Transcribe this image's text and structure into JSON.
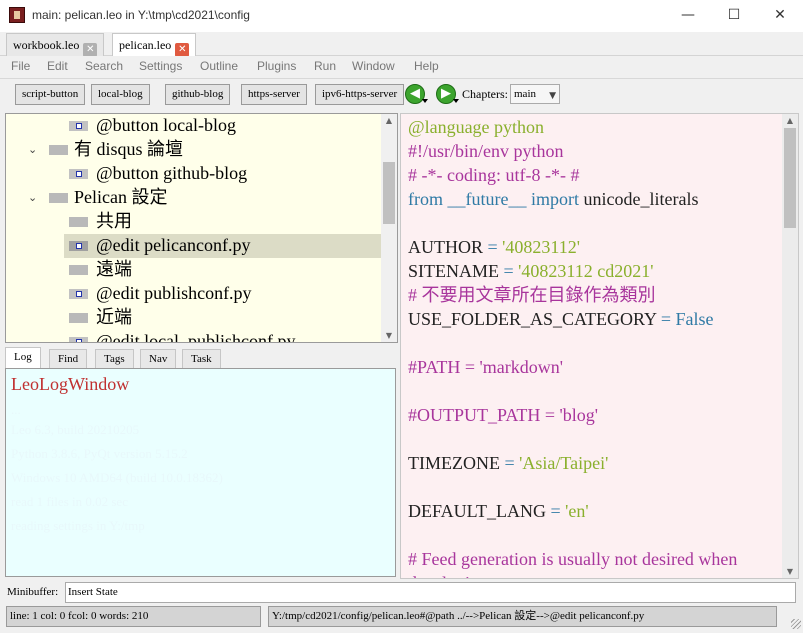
{
  "window": {
    "title": "main: pelican.leo in Y:\\tmp\\cd2021\\config",
    "minimize": "—",
    "maximize": "☐",
    "close": "✕"
  },
  "tabs": [
    {
      "label": "workbook.leo",
      "close": "✕"
    },
    {
      "label": "pelican.leo",
      "close": "✕"
    }
  ],
  "menu": [
    "File",
    "Edit",
    "Search",
    "Settings",
    "Outline",
    "Plugins",
    "Run",
    "Window",
    "Help"
  ],
  "toolbar": {
    "buttons": [
      "script-button",
      "local-blog",
      "github-blog",
      "https-server",
      "ipv6-https-server"
    ],
    "back_glyph": "◀",
    "forward_glyph": "▶",
    "chapters_label": "Chapters:",
    "chapters_value": "main",
    "chapters_arrow": "▼"
  },
  "outline": {
    "nodes": [
      {
        "text": "@button local-blog"
      },
      {
        "text": "有 disqus 論壇",
        "expander": "⌄"
      },
      {
        "text": "@button github-blog"
      },
      {
        "text": "Pelican 設定",
        "expander": "⌄"
      },
      {
        "text": "共用"
      },
      {
        "text": "@edit pelicanconf.py"
      },
      {
        "text": "遠端"
      },
      {
        "text": "@edit publishconf.py"
      },
      {
        "text": "近端"
      },
      {
        "text": "@edit local_publishconf.py"
      }
    ]
  },
  "log_tabs": [
    "Log",
    "Find",
    "Tags",
    "Nav",
    "Task"
  ],
  "log": {
    "title": "LeoLogWindow",
    "faded_lines": [
      "...",
      "Leo 6.3, build 20210205",
      "Python 3.8.6, PyQt version 5.15.2",
      "Windows 10 AMD64 (build 10.0.18362)",
      "read 1 files in 0.02 sec",
      "reading settings in Y:/tmp"
    ]
  },
  "body": {
    "lines": [
      [
        {
          "t": "@language python",
          "c": "c-green"
        }
      ],
      [
        {
          "t": "#!/usr/bin/env python",
          "c": "c-purple"
        }
      ],
      [
        {
          "t": "# -*- coding: utf-8 -*- #",
          "c": "c-purple"
        }
      ],
      [
        {
          "t": "from ",
          "c": "c-blue"
        },
        {
          "t": "__future__",
          "c": "c-blue"
        },
        {
          "t": " import ",
          "c": "c-blue"
        },
        {
          "t": "unicode_literals",
          "c": "c-black"
        }
      ],
      [],
      [
        {
          "t": "AUTHOR ",
          "c": "c-black"
        },
        {
          "t": "= ",
          "c": "c-op"
        },
        {
          "t": "'40823112'",
          "c": "c-green"
        }
      ],
      [
        {
          "t": "SITENAME ",
          "c": "c-black"
        },
        {
          "t": "= ",
          "c": "c-op"
        },
        {
          "t": "'40823112 cd2021'",
          "c": "c-green"
        }
      ],
      [
        {
          "t": "# 不要用文章所在目錄作為類別",
          "c": "c-purple"
        }
      ],
      [
        {
          "t": "USE_FOLDER_AS_CATEGORY ",
          "c": "c-black"
        },
        {
          "t": "= False",
          "c": "c-op"
        }
      ],
      [],
      [
        {
          "t": "#PATH = 'markdown'",
          "c": "c-purple"
        }
      ],
      [],
      [
        {
          "t": "#OUTPUT_PATH = 'blog'",
          "c": "c-purple"
        }
      ],
      [],
      [
        {
          "t": "TIMEZONE ",
          "c": "c-black"
        },
        {
          "t": "= ",
          "c": "c-op"
        },
        {
          "t": "'Asia/Taipei'",
          "c": "c-green"
        }
      ],
      [],
      [
        {
          "t": "DEFAULT_LANG ",
          "c": "c-black"
        },
        {
          "t": "= ",
          "c": "c-op"
        },
        {
          "t": "'en'",
          "c": "c-green"
        }
      ],
      [],
      [
        {
          "t": "# Feed generation is usually not desired when",
          "c": "c-purple"
        }
      ],
      [
        {
          "t": "developing",
          "c": "c-purple"
        }
      ]
    ]
  },
  "minibuffer": {
    "label": "Minibuffer:",
    "value": "Insert State"
  },
  "status": {
    "left": "line: 1 col: 0  fcol: 0 words: 210",
    "right": "Y:/tmp/cd2021/config/pelican.leo#@path ../-->Pelican 設定-->@edit pelicanconf.py"
  },
  "colors": {
    "outline_bg": "#ffffea",
    "log_bg": "#eaffff",
    "body_bg": "#fdf0f2",
    "accent_close": "#e05a40"
  }
}
